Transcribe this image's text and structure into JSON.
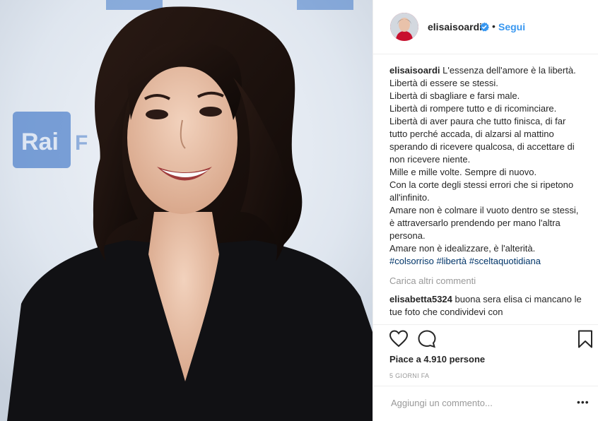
{
  "photo": {
    "alt_sign": "Rai",
    "sign_fragment": "F"
  },
  "header": {
    "username": "elisaisoardi",
    "separator": "•",
    "follow_label": "Segui"
  },
  "caption": {
    "username": "elisaisoardi",
    "text": "L'essenza dell'amore è la libertà.\nLibertà di essere se stessi.\nLibertà di sbagliare e farsi male.\nLibertà di rompere tutto e di ricominciare.\nLibertà di aver paura che tutto finisca, di far tutto perché accada, di alzarsi al mattino sperando di ricevere qualcosa, di accettare di non ricevere niente.\nMille e mille volte. Sempre di nuovo.\nCon la corte degli stessi errori che si ripetono all'infinito.\nAmare non è colmare il vuoto dentro se stessi, è attraversarlo prendendo per mano l'altra persona.\nAmare non è idealizzare, è l'alterità.",
    "hashtags": [
      "#colsorriso",
      "#libertà",
      "#sceltaquotidiana"
    ]
  },
  "load_more_label": "Carica altri commenti",
  "comments": [
    {
      "username": "elisabetta5324",
      "text": "buona sera elisa ci mancano le tue foto che condividevi con"
    }
  ],
  "likes_label": "Piace a 4.910 persone",
  "time_label": "5 GIORNI FA",
  "add_comment": {
    "placeholder": "Aggiungi un commento..."
  },
  "more_label": "•••",
  "colors": {
    "accent": "#3897f0",
    "verified": "#3897f0",
    "hashtag": "#003569",
    "muted": "#999999"
  }
}
